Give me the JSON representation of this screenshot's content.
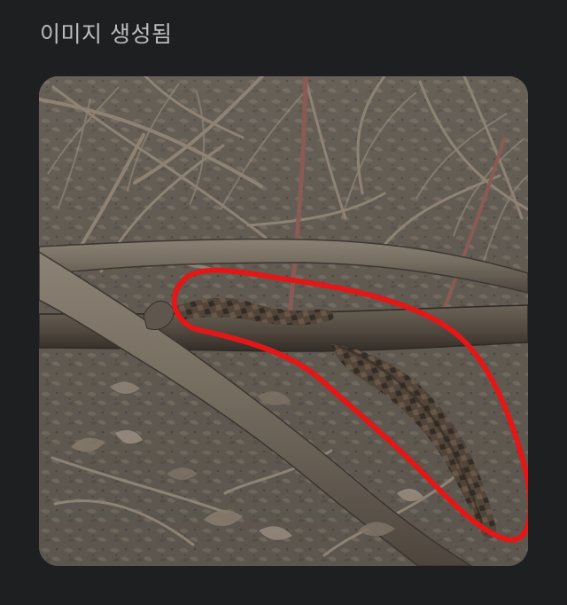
{
  "header": {
    "title": "이미지 생성됨"
  },
  "generated_image": {
    "subject": "camouflaged-snake-in-leaf-litter",
    "annotation": "red-highlight-loop",
    "colors": {
      "ground": "#5f5a52",
      "litter": "#7b7062",
      "branch": "#6e655a",
      "branch_highlight": "#8d8477",
      "twig": "#8b7f71",
      "reddish_stem": "#8a5b55",
      "snake_body": "#4c4036",
      "snake_band": "#2f2822",
      "highlight_loop": "#e31717"
    }
  }
}
